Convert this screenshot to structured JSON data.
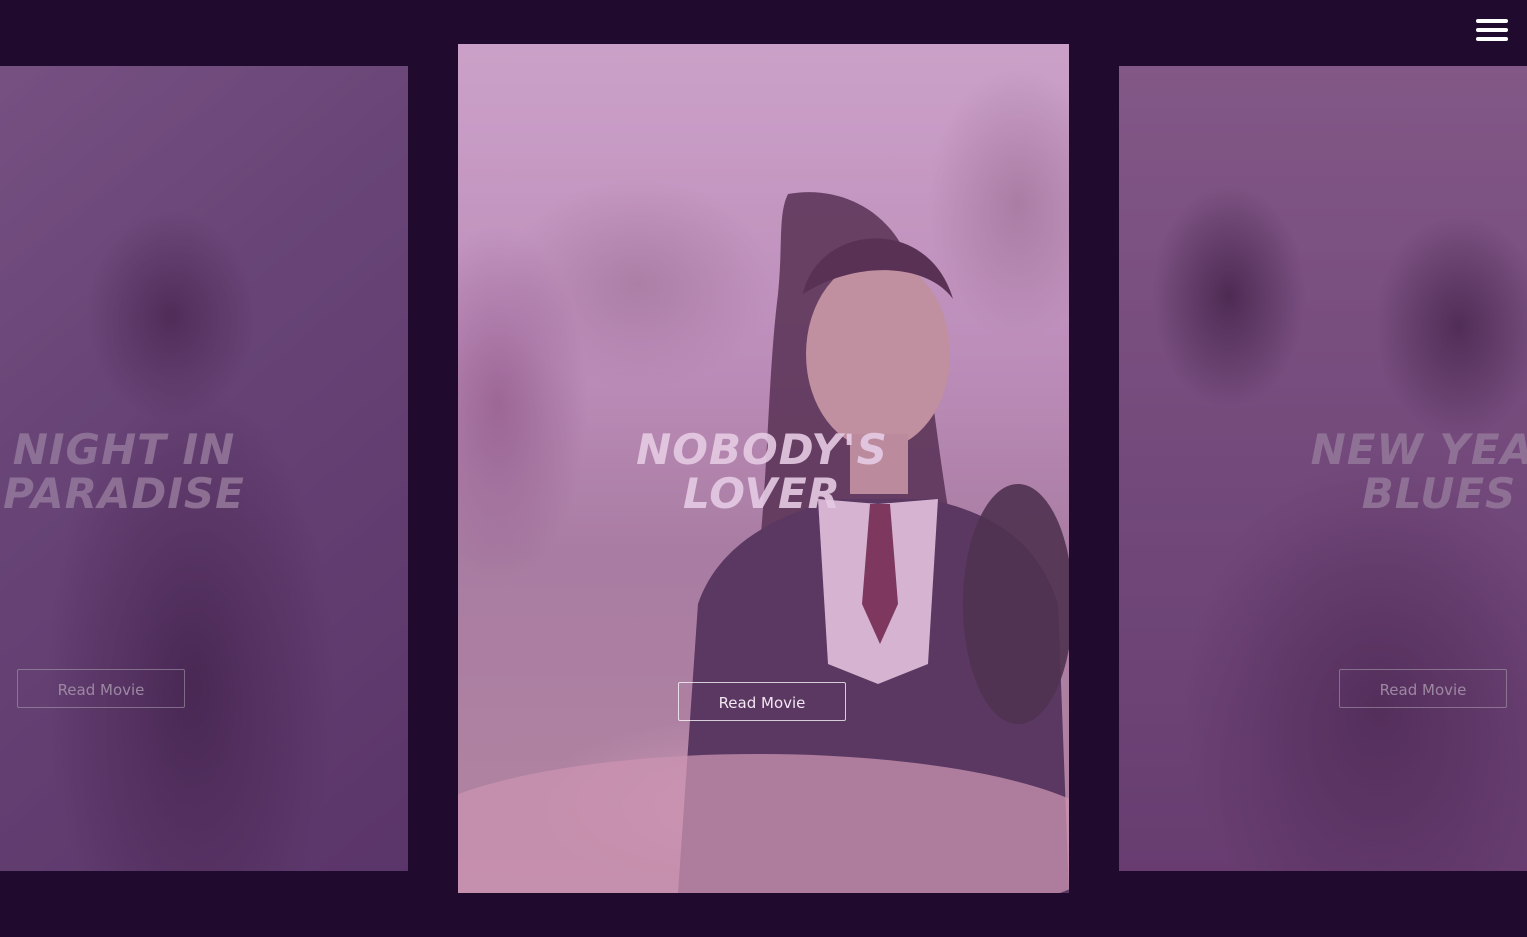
{
  "menu": {
    "icon": "hamburger-menu-icon"
  },
  "slides": [
    {
      "title": "NIGHT IN\nPARADISE",
      "button_label": "Read Movie"
    },
    {
      "title": "NOBODY'S\nLOVER",
      "button_label": "Read Movie"
    },
    {
      "title": "NEW YEAR\nBLUES",
      "button_label": "Read Movie"
    }
  ],
  "colors": {
    "background": "#200a2e",
    "overlay": "#aa5aa5",
    "title": "#d8b7da",
    "button_border": "#ffffff"
  }
}
